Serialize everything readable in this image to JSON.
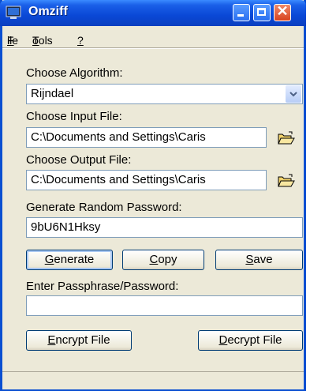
{
  "window": {
    "title": "Omziff"
  },
  "menu": [
    {
      "label_u": "F",
      "label_rest": "ile"
    },
    {
      "label_u": "T",
      "label_rest": "ools"
    },
    {
      "label_u": "?",
      "label_rest": ""
    }
  ],
  "algorithm": {
    "label": "Choose Algorithm:",
    "value": "Rijndael"
  },
  "input_file": {
    "label": "Choose Input File:",
    "value": "C:\\Documents and Settings\\Caris"
  },
  "output_file": {
    "label": "Choose Output File:",
    "value": "C:\\Documents and Settings\\Caris"
  },
  "random_password": {
    "label": "Generate Random Password:",
    "value": "9bU6N1Hksy"
  },
  "buttons": {
    "generate": {
      "u": "G",
      "rest": "enerate"
    },
    "copy": {
      "u": "C",
      "rest": "opy"
    },
    "save": {
      "u": "S",
      "rest": "ave"
    },
    "encrypt": {
      "u": "E",
      "rest": "ncrypt File"
    },
    "decrypt": {
      "u": "D",
      "rest": "ecrypt File"
    }
  },
  "passphrase": {
    "label": "Enter Passphrase/Password:",
    "value": ""
  },
  "colors": {
    "titlebar": "#0a48d6",
    "window_bg": "#ece9d8",
    "field_border": "#7f9db9"
  }
}
